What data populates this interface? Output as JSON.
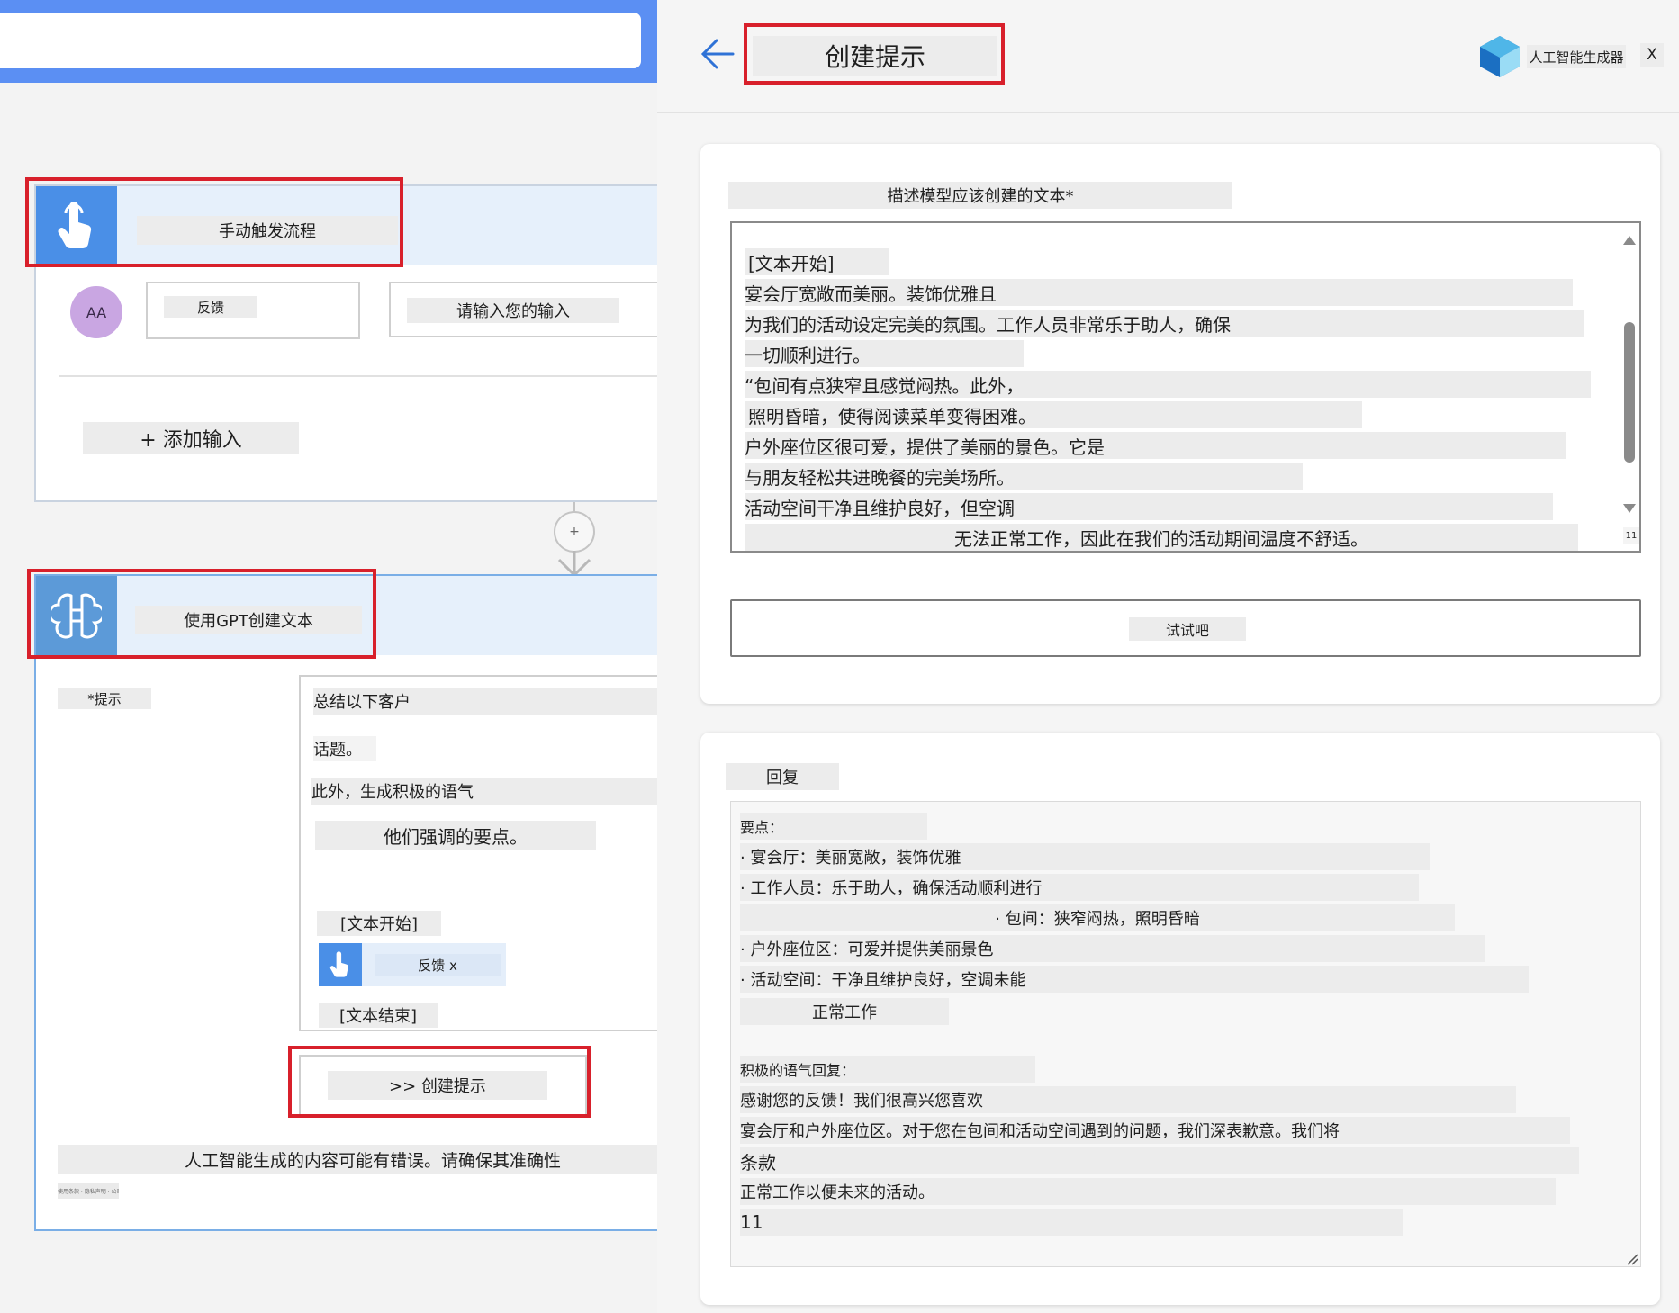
{
  "flow": {
    "trigger": {
      "title": "手动触发流程",
      "avatar": "AA",
      "field_label": "反馈",
      "field_placeholder": "请输入您的输入",
      "add_input": "+ 添加输入"
    },
    "connector_plus": "+",
    "gpt": {
      "title": "使用GPT创建文本",
      "prompt_label": "*提示",
      "prompt_lines": [
        "总结以下客户",
        "话题。",
        "此外，生成积极的语气",
        "他们强调的要点。"
      ],
      "text_start": "[文本开始]",
      "token_label": "反馈 x",
      "text_end": "[文本结束]",
      "create_prompt_button": ">> 创建提示",
      "disclaimer": "人工智能生成的内容可能有错误。请确保其准确性",
      "small_note": "使用条款 · 隐私声明 · 公司"
    }
  },
  "panel": {
    "title": "创建提示",
    "brand": "人工智能生成器",
    "close": "X",
    "describe_label": "描述模型应该创建的文本*",
    "prompt_text": [
      "[文本开始]",
      "宴会厅宽敞而美丽。装饰优雅且",
      "为我们的活动设定完美的氛围。工作人员非常乐于助人，确保",
      "一切顺利进行。",
      "“包间有点狭窄且感觉闷热。此外，",
      "照明昏暗，使得阅读菜单变得困难。",
      "户外座位区很可爱，提供了美丽的景色。它是",
      "与朋友轻松共进晚餐的完美场所。",
      "活动空间干净且维护良好，但空调",
      "无法正常工作，因此在我们的活动期间温度不舒适。"
    ],
    "char_count": "11",
    "try_button": "试试吧",
    "response_label": "回复",
    "response_lines": [
      "要点：",
      "· 宴会厅：美丽宽敞，装饰优雅",
      "· 工作人员：乐于助人，确保活动顺利进行",
      "· 包间：狭窄闷热，照明昏暗",
      "· 户外座位区：可爱并提供美丽景色",
      "· 活动空间：干净且维护良好，空调未能",
      "正常工作",
      "积极的语气回复：",
      "感谢您的反馈！我们很高兴您喜欢",
      "宴会厅和户外座位区。对于您在包间和活动空间遇到的问题，我们深表歉意。我们将",
      "条款",
      "正常工作以便未来的活动。",
      "11"
    ]
  },
  "colors": {
    "accent": "#4a8fe7",
    "highlight": "#d8202b",
    "topbar": "#5b8ff3"
  },
  "icons": [
    "touch-hand-icon",
    "gpt-brain-icon",
    "add-step-icon",
    "down-arrow-icon",
    "back-arrow-icon",
    "ai-builder-logo-icon",
    "resize-grip-icon"
  ]
}
